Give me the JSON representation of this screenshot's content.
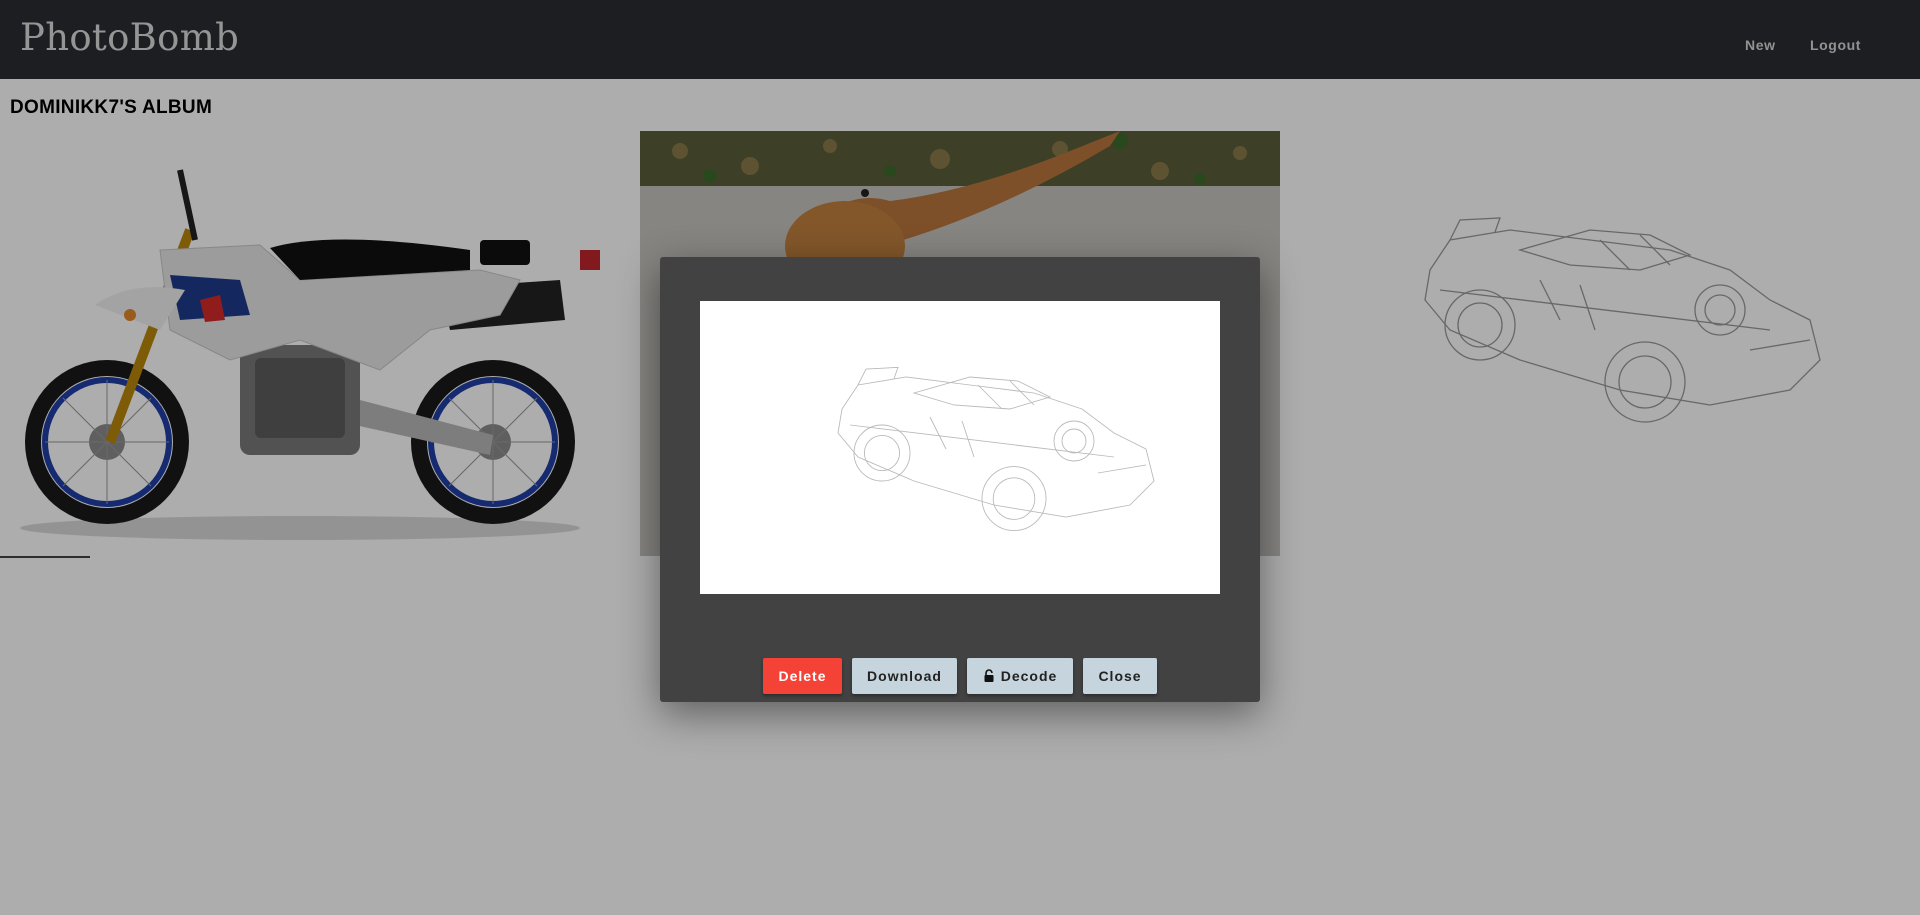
{
  "navbar": {
    "brand": "PhotoBomb",
    "links": {
      "new": "New",
      "logout": "Logout"
    }
  },
  "album": {
    "title": "DOMINIKK7'S ALBUM",
    "photos": [
      {
        "subject": "motorcycle"
      },
      {
        "subject": "bearded-dragon-lizard"
      },
      {
        "subject": "car-sketch"
      }
    ]
  },
  "modal": {
    "image_subject": "car-sketch",
    "buttons": {
      "delete": "Delete",
      "download": "Download",
      "decode": "Decode",
      "close": "Close"
    },
    "decode_icon": "lock-icon"
  },
  "colors": {
    "navbar_bg": "#2a2d33",
    "modal_bg": "#424242",
    "delete_button": "#f44336",
    "secondary_button": "#c5d4dd"
  }
}
